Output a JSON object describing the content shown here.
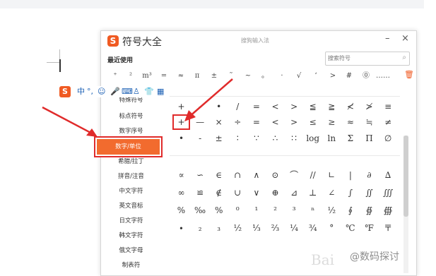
{
  "window": {
    "logo": "S",
    "title": "符号大全",
    "subtitle": "搜狗输入法",
    "minimize": "–",
    "close": "×"
  },
  "recent": {
    "label": "最近使用",
    "search_placeholder": "搜索符号",
    "symbols": [
      "⁺",
      "²",
      "m³",
      "=",
      "≈",
      "π",
      "±",
      "˜",
      "~",
      "。",
      "·",
      "√",
      "‘",
      ">",
      "#",
      "⓪",
      "……"
    ]
  },
  "ime_toolbar": {
    "logo": "S",
    "items": [
      "中",
      "°,",
      "☺",
      "🎤",
      "⌨",
      "♙",
      "👕",
      "▦"
    ]
  },
  "sidebar": {
    "items": [
      "特殊符号",
      "标点符号",
      "数字序号",
      "数字/单位",
      "希腊/拉丁",
      "拼音/注音",
      "中文字符",
      "英文音标",
      "日文字符",
      "韩文字符",
      "俄文字母",
      "制表符"
    ],
    "active_index": 3
  },
  "symbol_grid": {
    "rows": [
      [
        "+",
        "-",
        "•",
        "/",
        "=",
        "<",
        ">",
        "≦",
        "≧",
        "≮",
        "≯",
        "≡"
      ],
      [
        "+",
        "—",
        "×",
        "÷",
        "=",
        "<",
        ">",
        "≤",
        "≥",
        "≈",
        "≒",
        "≠"
      ],
      [
        "•",
        "-",
        "±",
        "∶",
        "∵",
        "∴",
        "∷",
        "log",
        "ln",
        "Σ",
        "Π",
        "∅"
      ],
      [
        "∝",
        "∽",
        "∈",
        "∩",
        "∧",
        "⊙",
        "⌒",
        "//",
        "∟",
        "|",
        "∂",
        "∆"
      ],
      [
        "∞",
        "≌",
        "∉",
        "∪",
        "∨",
        "⊕",
        "⊿",
        "⊥",
        "∠",
        "∫",
        "∬",
        "∭"
      ],
      [
        "%",
        "‰",
        "%",
        "⁰",
        "¹",
        "²",
        "³",
        "ⁿ",
        "½",
        "∮",
        "∯",
        "∰"
      ],
      [
        "∙",
        "₂",
        "₃",
        "½",
        "⅓",
        "⅔",
        "¼",
        "¾",
        "°",
        "℃",
        "℉",
        "〒"
      ]
    ],
    "highlight_cell": [
      1,
      0
    ]
  },
  "watermark": {
    "brand_faded": "Bai",
    "text": "@数码探讨"
  },
  "colors": {
    "accent": "#f05a22",
    "highlight": "#e02b2b",
    "active_bg": "#f26b2e"
  }
}
